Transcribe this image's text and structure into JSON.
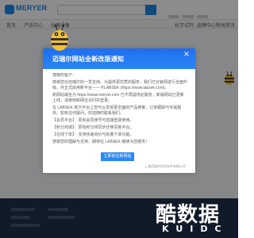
{
  "header": {
    "brand": "MERYER",
    "nav_items": [
      "首页",
      "产品中心",
      "仪器设备",
      "化学试剂",
      "品牌中心",
      "新闻资讯"
    ]
  },
  "modal": {
    "title": "迈瑞尔网站全新改版通知",
    "close_label": "×",
    "greeting": "尊敬的客户：",
    "paragraphs": [
      "感谢您对迈瑞尔的一贯支持。为提供更优质的服务，我们已对官网进行全面升级，并正式启用新平台——卡LABSEK (https://www.labsek.com)。",
      "新网站域名为 https://www.meryer.com 已不再提供此服务，新版网站已更新上线，请使用新网址访问并登录。",
      "在 LABSEK 官方平台上您可以享受更全面的产品搜索、订单跟踪与专属服务。如有任何疑问，欢迎随时联系我们。",
      "【会员平台】：原有会员账号可直接登录使用。",
      "【积分商城】：原有积分将同步迁移至新平台。",
      "【在线下单】：支持快速询价与批量下单功能。",
      "感谢您的理解与支持，期待在 LABSEK 继续为您服务！"
    ],
    "button_label": "立即前往新网站",
    "footer_text": "上海迈瑞尔化学技术有限公司"
  },
  "watermark": {
    "title": "酷数据",
    "subtitle": "KUIDC"
  }
}
